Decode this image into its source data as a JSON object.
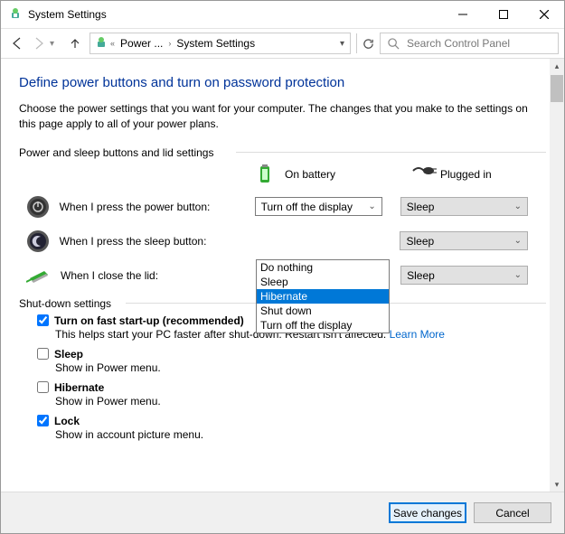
{
  "titlebar": {
    "title": "System Settings"
  },
  "nav": {
    "crumb1": "Power ...",
    "crumb2": "System Settings",
    "searchPlaceholder": "Search Control Panel"
  },
  "page": {
    "heading": "Define power buttons and turn on password protection",
    "intro": "Choose the power settings that you want for your computer. The changes that you make to the settings on this page apply to all of your power plans.",
    "section1": "Power and sleep buttons and lid settings",
    "col_battery": "On battery",
    "col_plugged": "Plugged in",
    "row_power": "When I press the power button:",
    "row_sleep": "When I press the sleep button:",
    "row_lid": "When I close the lid:",
    "power_battery_value": "Turn off the display",
    "sleep_plugged_value": "Sleep",
    "lid_plugged_value": "Sleep",
    "dropdown_options": [
      "Do nothing",
      "Sleep",
      "Hibernate",
      "Shut down",
      "Turn off the display"
    ],
    "dropdown_selected_index": 2,
    "section2": "Shut-down settings",
    "sd_fast": "Turn on fast start-up (recommended)",
    "sd_fast_desc": "This helps start your PC faster after shut-down. Restart isn't affected. ",
    "sd_fast_link": "Learn More",
    "sd_sleep": "Sleep",
    "sd_sleep_desc": "Show in Power menu.",
    "sd_hibernate": "Hibernate",
    "sd_hibernate_desc": "Show in Power menu.",
    "sd_lock": "Lock",
    "sd_lock_desc": "Show in account picture menu.",
    "sd_checked": {
      "fast": true,
      "sleep": false,
      "hibernate": false,
      "lock": true
    }
  },
  "footer": {
    "save": "Save changes",
    "cancel": "Cancel"
  }
}
